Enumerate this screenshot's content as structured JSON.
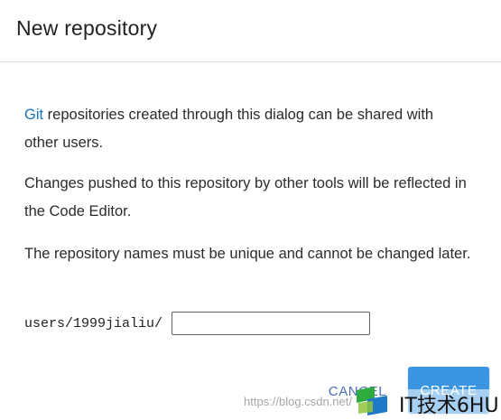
{
  "dialog": {
    "title": "New repository",
    "paragraphs": {
      "p1_link": "Git",
      "p1_rest": " repositories created through this dialog can be shared with other users.",
      "p2": "Changes pushed to this repository by other tools will be reflected in the Code Editor.",
      "p3": "The repository names must be unique and cannot be changed later."
    },
    "path_prefix": "users/1999jialiu/",
    "repo_name_value": "",
    "buttons": {
      "cancel": "CANCEL",
      "create": "CREATE"
    }
  },
  "watermark": {
    "url": "https://blog.csdn.net/",
    "logo_icon": "it-6hu-logo-icon",
    "text": "IT技术6HU"
  },
  "colors": {
    "link": "#1a73b8",
    "cancel_text": "#4a6fb5",
    "create_bg": "#3b95e0",
    "divider": "#e0e0e0"
  }
}
